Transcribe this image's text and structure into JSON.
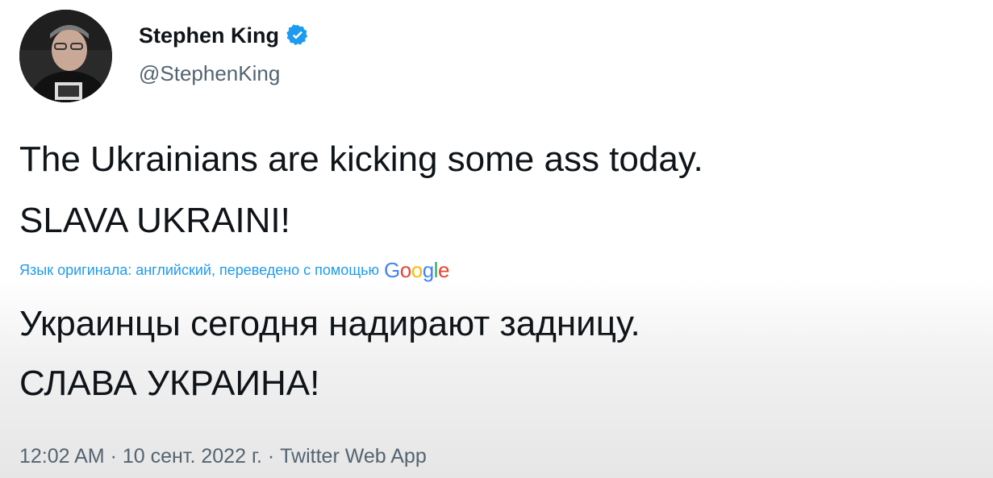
{
  "author": {
    "display_name": "Stephen King",
    "handle": "@StephenKing",
    "verified_icon": "verified-badge-icon"
  },
  "tweet": {
    "line1": "The Ukrainians are kicking some ass today.",
    "line2": "SLAVA UKRAINI!",
    "translation_note": "Язык оригинала: английский, переведено с помощью",
    "translation_provider": "Google",
    "translated_line1": "Украинцы сегодня надирают задницу.",
    "translated_line2": "СЛАВА УКРАИНА!",
    "meta": "12:02 AM · 10 сент. 2022 г. · Twitter Web App"
  },
  "colors": {
    "text": "#0f1419",
    "secondary": "#536471",
    "accent": "#1d9bf0",
    "google_blue": "#4285F4",
    "google_red": "#EA4335",
    "google_yellow": "#FBBC05",
    "google_green": "#34A853"
  }
}
